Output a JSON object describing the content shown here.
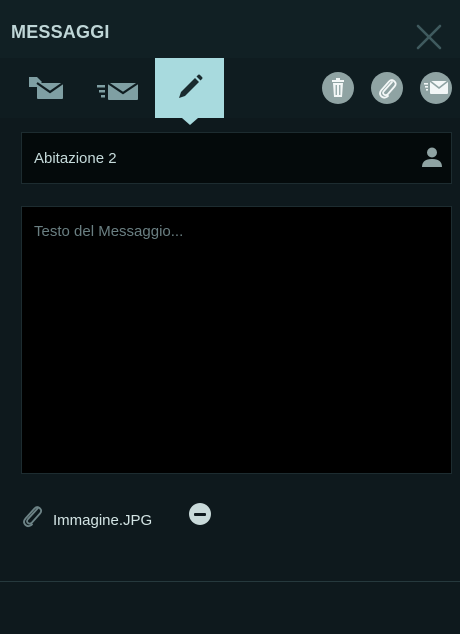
{
  "header": {
    "title": "MESSAGGI"
  },
  "toolbar": {
    "tabs": [
      {
        "icon": "inbox-icon",
        "active": false
      },
      {
        "icon": "sent-icon",
        "active": false
      },
      {
        "icon": "compose-pencil-icon",
        "active": true
      }
    ],
    "actions": [
      {
        "icon": "trash-icon"
      },
      {
        "icon": "paperclip-icon"
      },
      {
        "icon": "send-icon"
      }
    ]
  },
  "compose": {
    "recipient": "Abitazione 2",
    "message_value": "",
    "message_placeholder": "Testo del Messaggio...",
    "attachment": {
      "filename": "Immagine.JPG"
    }
  },
  "colors": {
    "background": "#0e191d",
    "accent_active": "#a8dade",
    "icon": "#7f9fa3",
    "circle_button": "#8fa3a3"
  }
}
